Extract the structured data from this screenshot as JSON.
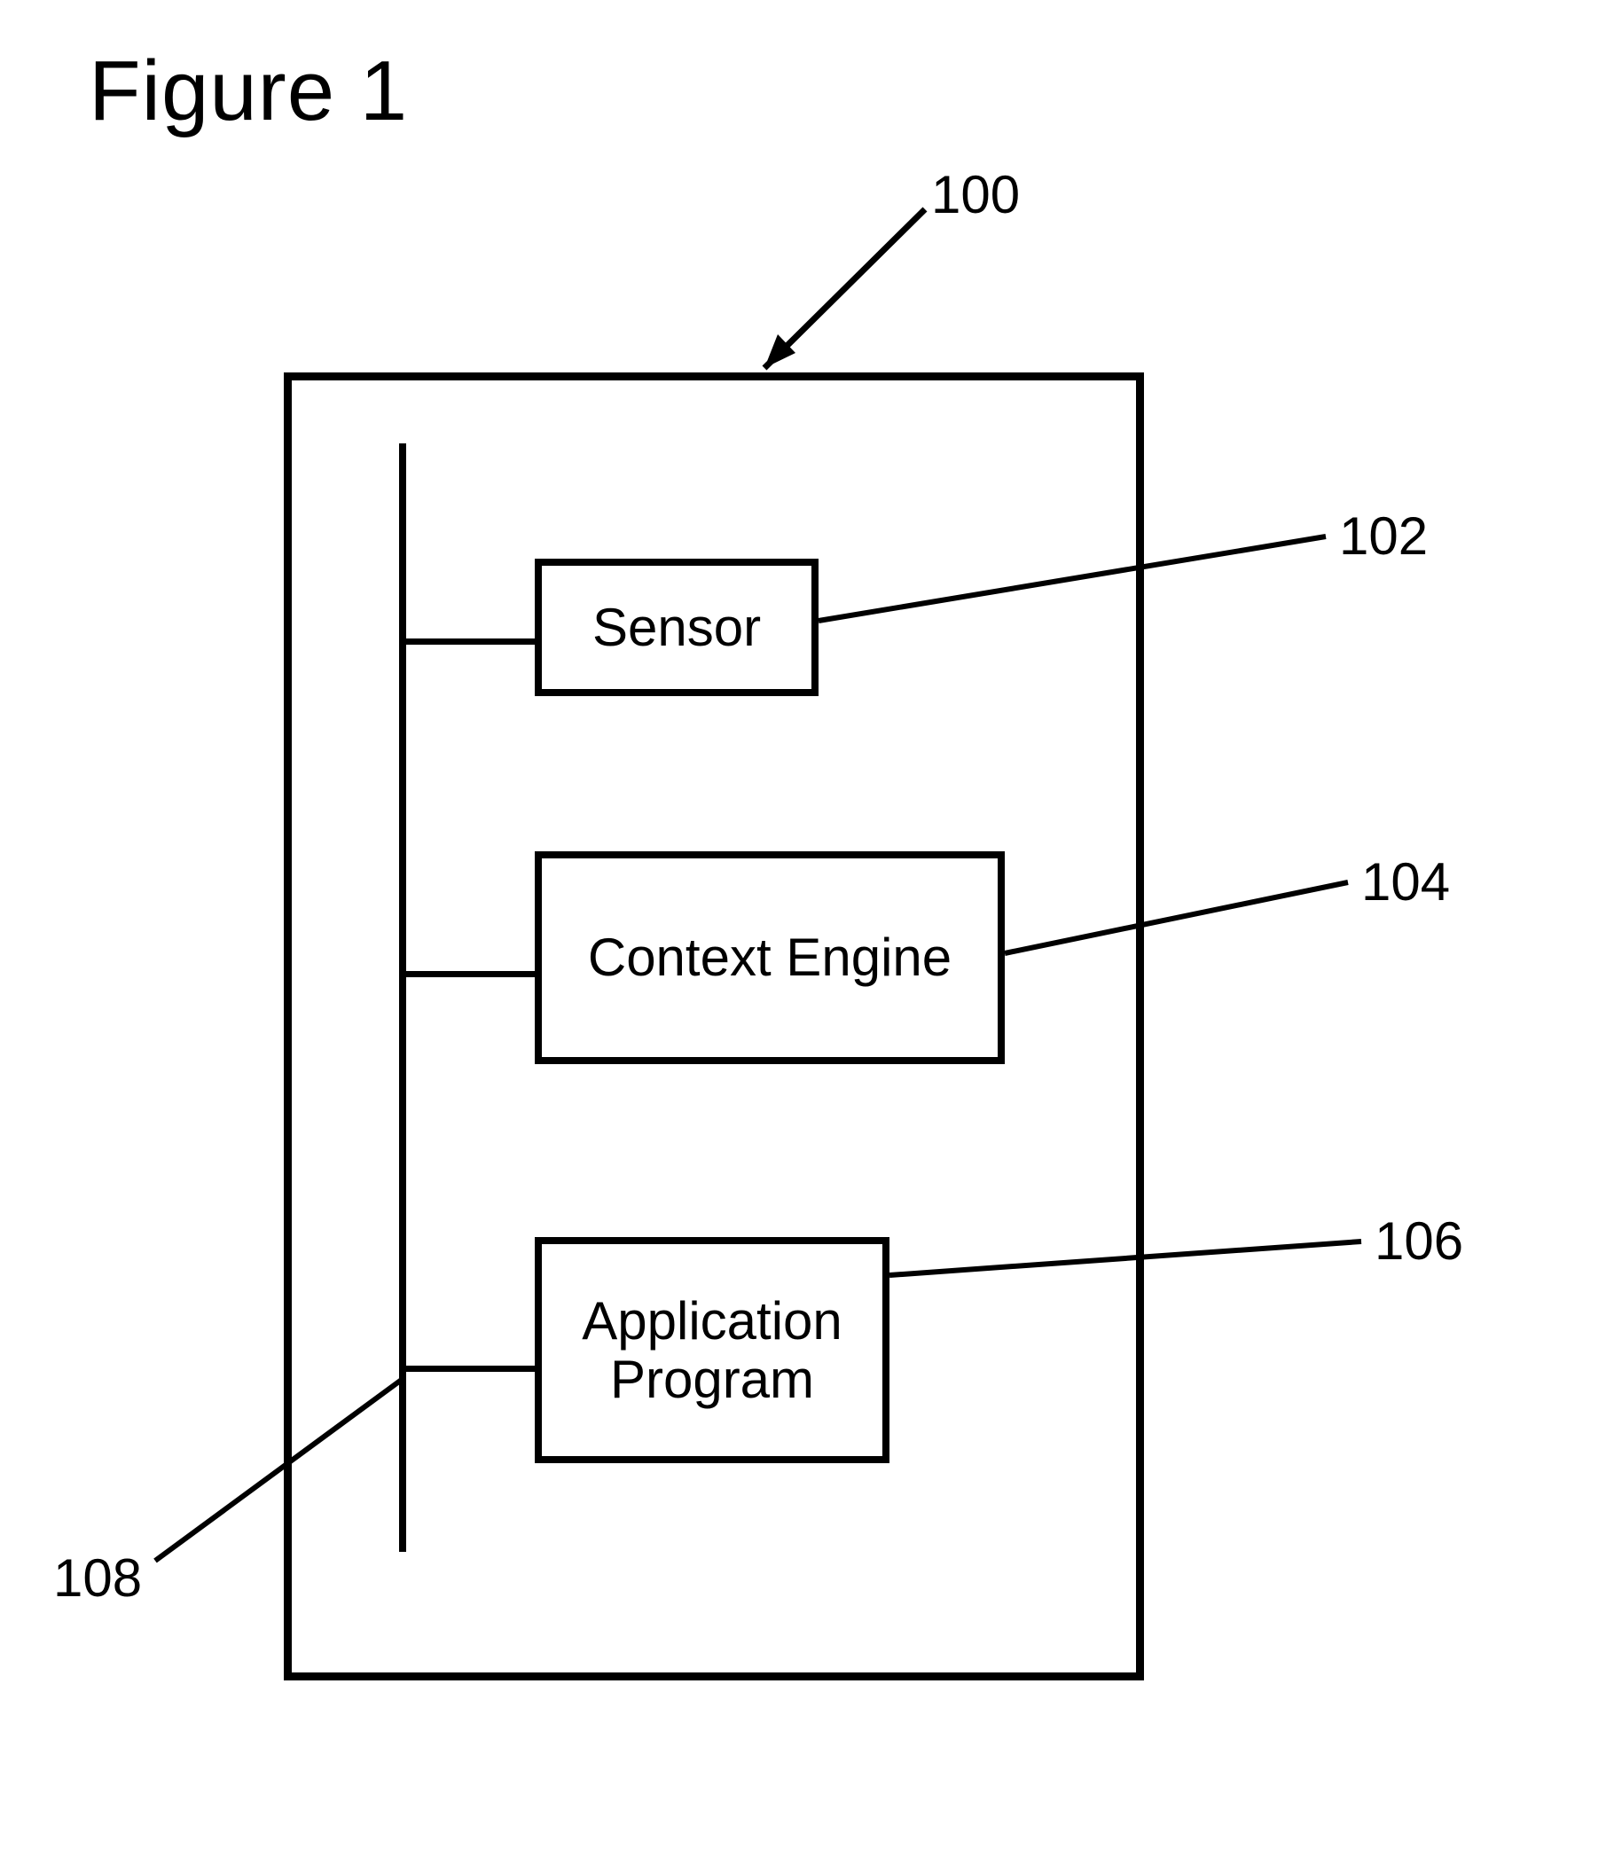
{
  "figure": {
    "title": "Figure 1"
  },
  "blocks": {
    "sensor": {
      "label": "Sensor"
    },
    "context_engine": {
      "label": "Context Engine"
    },
    "application_program": {
      "label": "Application\nProgram"
    }
  },
  "refs": {
    "outer": "100",
    "sensor": "102",
    "context_engine": "104",
    "application_program": "106",
    "bus": "108"
  }
}
